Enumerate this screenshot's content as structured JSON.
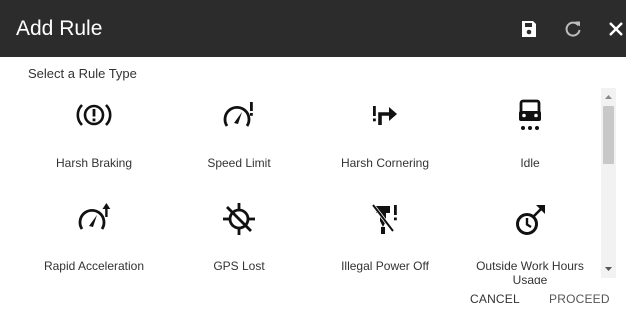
{
  "header": {
    "title": "Add Rule",
    "icons": [
      "save-icon",
      "refresh-icon",
      "close-icon"
    ],
    "background": "#2c2c2c"
  },
  "subtitle": "Select a Rule Type",
  "rule_types": [
    {
      "label": "Harsh Braking",
      "icon": "brake-warning-icon"
    },
    {
      "label": "Speed Limit",
      "icon": "speedometer-alert-icon"
    },
    {
      "label": "Harsh Cornering",
      "icon": "turn-alert-icon"
    },
    {
      "label": "Idle",
      "icon": "car-idle-icon"
    },
    {
      "label": "Rapid Acceleration",
      "icon": "speedometer-up-icon"
    },
    {
      "label": "GPS Lost",
      "icon": "gps-off-icon"
    },
    {
      "label": "Illegal Power Off",
      "icon": "power-off-alert-icon"
    },
    {
      "label": "Outside Work Hours Usage",
      "icon": "clock-out-icon"
    }
  ],
  "footer": {
    "cancel": "CANCEL",
    "proceed": "PROCEED"
  }
}
